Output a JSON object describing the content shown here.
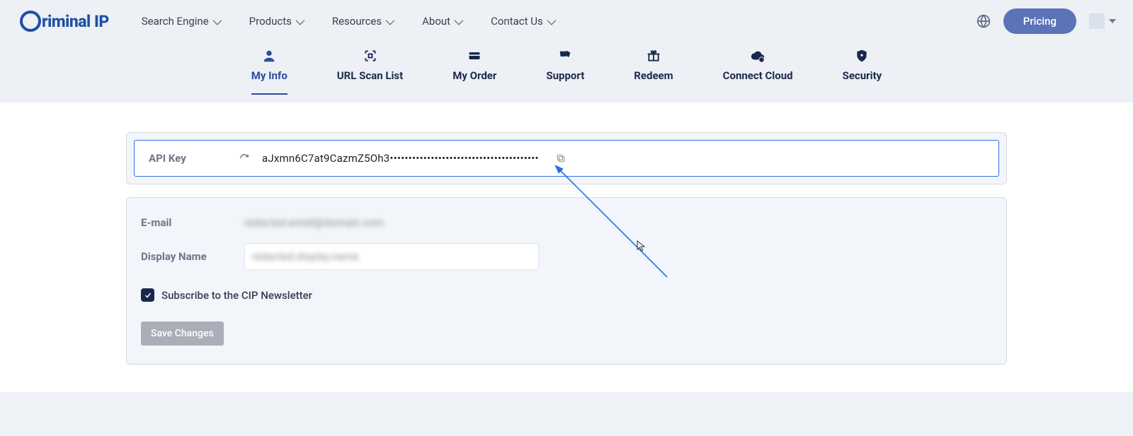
{
  "brand": {
    "name": "riminal IP"
  },
  "nav": {
    "items": [
      {
        "label": "Search Engine"
      },
      {
        "label": "Products"
      },
      {
        "label": "Resources"
      },
      {
        "label": "About"
      },
      {
        "label": "Contact Us"
      }
    ],
    "pricing": "Pricing"
  },
  "tabs": [
    {
      "label": "My Info",
      "active": true
    },
    {
      "label": "URL Scan List"
    },
    {
      "label": "My Order"
    },
    {
      "label": "Support"
    },
    {
      "label": "Redeem"
    },
    {
      "label": "Connect Cloud"
    },
    {
      "label": "Security"
    }
  ],
  "api": {
    "label": "API Key",
    "value": "aJxmn6C7at9CazmZ5Oh3••••••••••••••••••••••••••••••••••••••••"
  },
  "profile": {
    "email_label": "E-mail",
    "email_value": "redacted.email@domain.com",
    "display_name_label": "Display Name",
    "display_name_value": "redacted.display.name",
    "newsletter_label": "Subscribe to the CIP Newsletter",
    "newsletter_checked": true,
    "save_label": "Save Changes"
  },
  "colors": {
    "accent": "#2d4aa0",
    "highlight_border": "#2f6fe8",
    "panel_bg": "#f2f5fa"
  }
}
